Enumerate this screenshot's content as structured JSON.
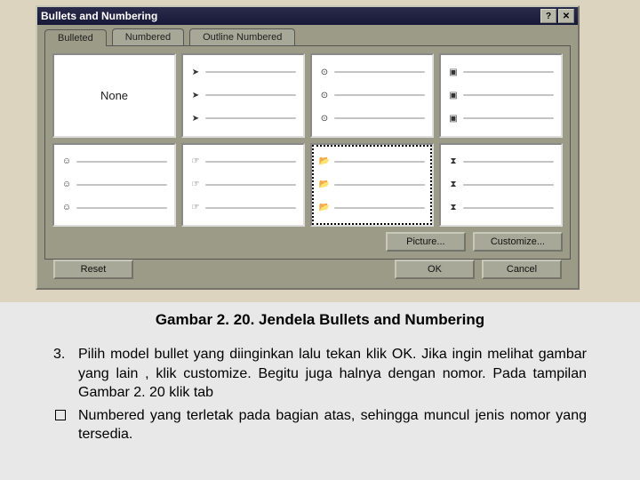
{
  "dialog": {
    "title": "Bullets and Numbering",
    "tabs": {
      "bulleted": "Bulleted",
      "numbered": "Numbered",
      "outline": "Outline Numbered"
    },
    "none": "None",
    "buttons": {
      "picture": "Picture...",
      "customize": "Customize...",
      "reset": "Reset",
      "ok": "OK",
      "cancel": "Cancel"
    }
  },
  "caption": "Gambar 2. 20. Jendela Bullets and Numbering",
  "body": {
    "item_num": "3.",
    "p1": "Pilih model bullet yang diinginkan lalu tekan klik OK. Jika ingin melihat gambar yang lain , klik customize. Begitu juga halnya dengan nomor. Pada tampilan Gambar 2. 20 klik tab",
    "p2": "Numbered yang terletak pada bagian atas, sehingga muncul jenis nomor yang tersedia."
  }
}
